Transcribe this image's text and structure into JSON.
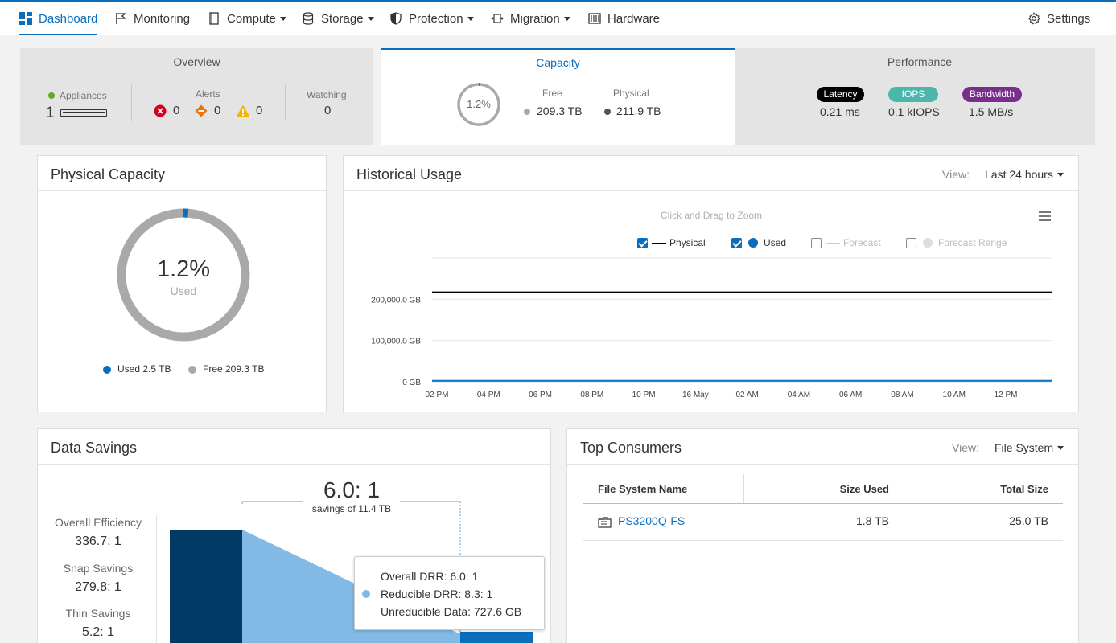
{
  "nav": {
    "dashboard": "Dashboard",
    "monitoring": "Monitoring",
    "compute": "Compute",
    "storage": "Storage",
    "protection": "Protection",
    "migration": "Migration",
    "hardware": "Hardware",
    "settings": "Settings"
  },
  "summary": {
    "overview": {
      "title": "Overview",
      "appliances_label": "Appliances",
      "appliances_count": "1",
      "alerts_label": "Alerts",
      "alerts_critical": "0",
      "alerts_major": "0",
      "alerts_minor": "0",
      "watching_label": "Watching",
      "watching_count": "0"
    },
    "capacity": {
      "title": "Capacity",
      "percent": "1.2%",
      "free_label": "Free",
      "free_value": "209.3 TB",
      "physical_label": "Physical",
      "physical_value": "211.9 TB"
    },
    "performance": {
      "title": "Performance",
      "latency_label": "Latency",
      "latency_value": "0.21 ms",
      "iops_label": "IOPS",
      "iops_value": "0.1 kIOPS",
      "bandwidth_label": "Bandwidth",
      "bandwidth_value": "1.5 MB/s"
    }
  },
  "physical_capacity": {
    "title": "Physical Capacity",
    "percent": "1.2%",
    "used_label": "Used",
    "used_fraction": 0.012,
    "legend_used": "Used 2.5 TB",
    "legend_free": "Free 209.3 TB"
  },
  "historical_usage": {
    "title": "Historical Usage",
    "view_label": "View:",
    "view_value": "Last 24 hours",
    "zoom_hint": "Click and Drag to Zoom",
    "legend": {
      "physical": "Physical",
      "used": "Used",
      "forecast": "Forecast",
      "forecast_range": "Forecast Range"
    }
  },
  "chart_data": {
    "type": "line",
    "title": "",
    "xlabel": "",
    "ylabel": "",
    "y_tick_labels": [
      "200,000.0 GB",
      "100,000.0 GB",
      "0 GB"
    ],
    "y_ticks": [
      200000,
      100000,
      0
    ],
    "ylim": [
      0,
      300000
    ],
    "x": [
      "02 PM",
      "04 PM",
      "06 PM",
      "08 PM",
      "10 PM",
      "16 May",
      "02 AM",
      "04 AM",
      "06 AM",
      "08 AM",
      "10 AM",
      "12 PM"
    ],
    "series": [
      {
        "name": "Physical",
        "color": "#000000",
        "values": [
          216986,
          216986,
          216986,
          216986,
          216986,
          216986,
          216986,
          216986,
          216986,
          216986,
          216986,
          216986
        ]
      },
      {
        "name": "Used",
        "color": "#0a6ebd",
        "values": [
          2560,
          2560,
          2560,
          2560,
          2560,
          2560,
          2560,
          2560,
          2560,
          2560,
          2560,
          2560
        ]
      }
    ],
    "grid": true,
    "legend_position": "top"
  },
  "data_savings": {
    "title": "Data Savings",
    "ratio": "6.0: 1",
    "savings_text": "savings of 11.4 TB",
    "overall_label": "Overall Efficiency",
    "overall_value": "336.7: 1",
    "snap_label": "Snap Savings",
    "snap_value": "279.8: 1",
    "thin_label": "Thin Savings",
    "thin_value": "5.2: 1",
    "tooltip": {
      "line1": "Overall DRR: 6.0: 1",
      "line2": "Reducible DRR: 8.3: 1",
      "line3": "Unreducible Data: 727.6 GB"
    }
  },
  "top_consumers": {
    "title": "Top Consumers",
    "view_label": "View:",
    "view_value": "File System",
    "columns": [
      "File System Name",
      "Size Used",
      "Total Size"
    ],
    "rows": [
      {
        "name": "PS3200Q-FS",
        "size_used": "1.8 TB",
        "total_size": "25.0 TB"
      }
    ]
  }
}
